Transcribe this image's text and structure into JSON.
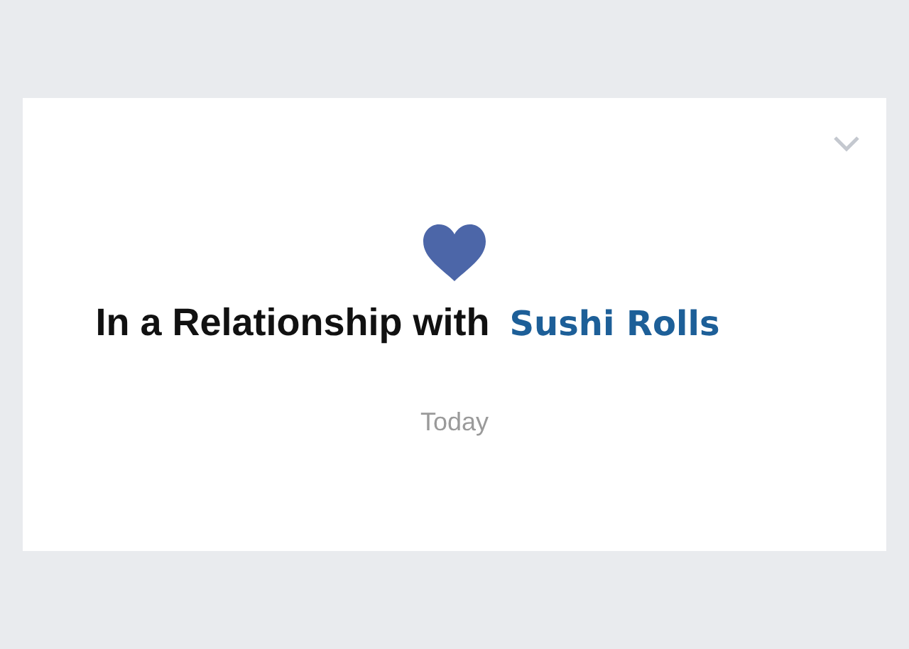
{
  "card": {
    "heading": "In a Relationship with",
    "partner": "Sushi Rolls",
    "date": "Today"
  }
}
